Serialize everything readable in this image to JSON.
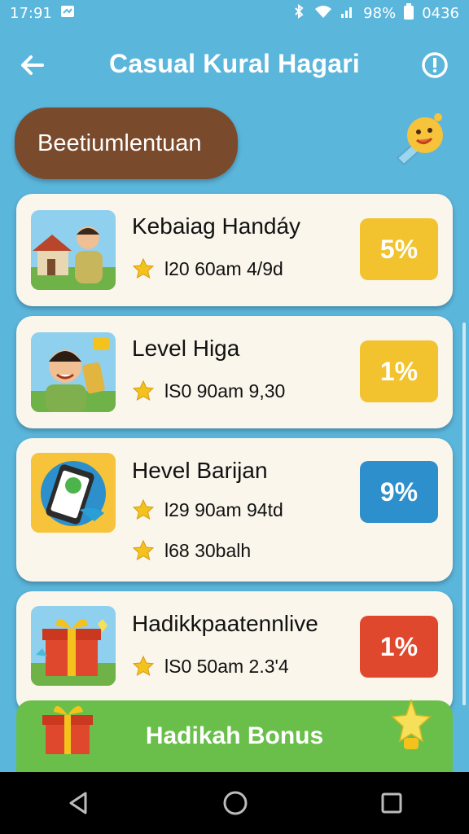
{
  "status_bar": {
    "time": "17:91",
    "battery": "98%",
    "clock_right": "0436"
  },
  "app_bar": {
    "title": "Casual Kural Hagari"
  },
  "chip": {
    "label": "Beetiumlentuan"
  },
  "list": [
    {
      "name": "Kebaiag Handáy",
      "lines": [
        "l20 60am 4/9d"
      ],
      "percent": "5%",
      "badge_color": "#f2c32e"
    },
    {
      "name": "Level Higa",
      "lines": [
        "lS0 90am 9,30"
      ],
      "percent": "1%",
      "badge_color": "#f2c32e"
    },
    {
      "name": "Hevel Barijan",
      "lines": [
        "l29 90am 94td",
        "l68 30balh"
      ],
      "percent": "9%",
      "badge_color": "#2d8fcb"
    },
    {
      "name": "Hadikkpaatennlive",
      "lines": [
        "lS0 50am 2.3'4"
      ],
      "percent": "1%",
      "badge_color": "#e0482d"
    }
  ],
  "bonus": {
    "label": "Hadikah Bonus"
  },
  "colors": {
    "background": "#5bb6dc",
    "chip": "#7a4a2d",
    "card": "#fbf6ec",
    "bonus": "#6abf4b"
  }
}
